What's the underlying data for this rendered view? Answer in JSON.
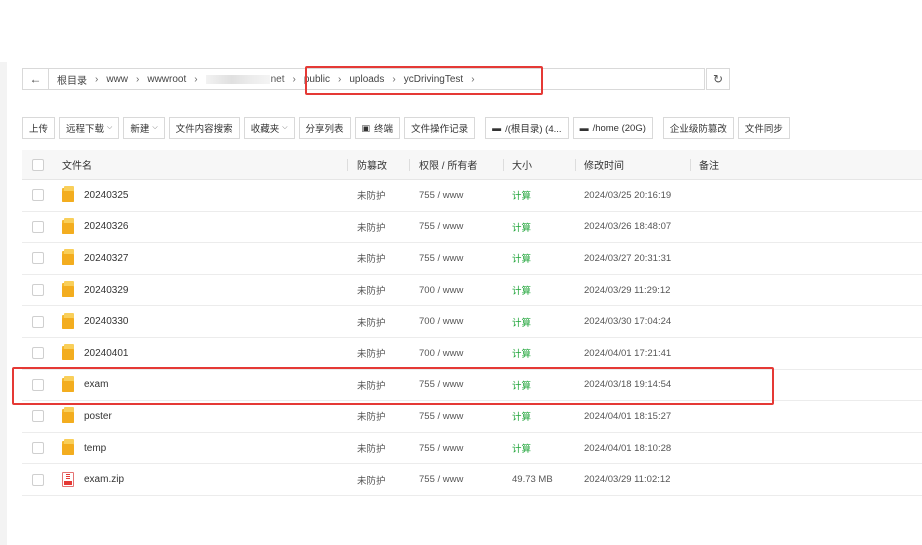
{
  "breadcrumb": {
    "items": [
      {
        "label": "根目录"
      },
      {
        "label": "www"
      },
      {
        "label": "wwwroot"
      },
      {
        "label": "net"
      },
      {
        "label": "public"
      },
      {
        "label": "uploads"
      },
      {
        "label": "ycDrivingTest"
      }
    ],
    "back_icon": "arrow-left-icon",
    "refresh_icon": "refresh-icon"
  },
  "toolbar": {
    "upload": "上传",
    "remote_download": "远程下载",
    "new": "新建",
    "content_search": "文件内容搜索",
    "favorites": "收藏夹",
    "share_list": "分享列表",
    "terminal": "终端",
    "operation_log": "文件操作记录",
    "disk_root": "/(根目录) (4...",
    "disk_home": "/home (20G)",
    "tamper_proof": "企业级防篡改",
    "file_sync": "文件同步"
  },
  "table": {
    "headers": {
      "name": "文件名",
      "protect": "防篡改",
      "perm": "权限 / 所有者",
      "size": "大小",
      "mtime": "修改时间",
      "note": "备注"
    },
    "rows": [
      {
        "name": "20240325",
        "type": "folder",
        "protect": "未防护",
        "perm": "755 / www",
        "size": "计算",
        "mtime": "2024/03/25 20:16:19"
      },
      {
        "name": "20240326",
        "type": "folder",
        "protect": "未防护",
        "perm": "755 / www",
        "size": "计算",
        "mtime": "2024/03/26 18:48:07"
      },
      {
        "name": "20240327",
        "type": "folder",
        "protect": "未防护",
        "perm": "755 / www",
        "size": "计算",
        "mtime": "2024/03/27 20:31:31"
      },
      {
        "name": "20240329",
        "type": "folder",
        "protect": "未防护",
        "perm": "700 / www",
        "size": "计算",
        "mtime": "2024/03/29 11:29:12"
      },
      {
        "name": "20240330",
        "type": "folder",
        "protect": "未防护",
        "perm": "700 / www",
        "size": "计算",
        "mtime": "2024/03/30 17:04:24"
      },
      {
        "name": "20240401",
        "type": "folder",
        "protect": "未防护",
        "perm": "700 / www",
        "size": "计算",
        "mtime": "2024/04/01 17:21:41"
      },
      {
        "name": "exam",
        "type": "folder",
        "protect": "未防护",
        "perm": "755 / www",
        "size": "计算",
        "mtime": "2024/03/18 19:14:54"
      },
      {
        "name": "poster",
        "type": "folder",
        "protect": "未防护",
        "perm": "755 / www",
        "size": "计算",
        "mtime": "2024/04/01 18:15:27"
      },
      {
        "name": "temp",
        "type": "folder",
        "protect": "未防护",
        "perm": "755 / www",
        "size": "计算",
        "mtime": "2024/04/01 18:10:28"
      },
      {
        "name": "exam.zip",
        "type": "zip",
        "protect": "未防护",
        "perm": "755 / www",
        "size": "49.73 MB",
        "mtime": "2024/03/29 11:02:12"
      }
    ]
  },
  "colors": {
    "highlight": "#e53935",
    "calc_link": "#20a53a"
  }
}
